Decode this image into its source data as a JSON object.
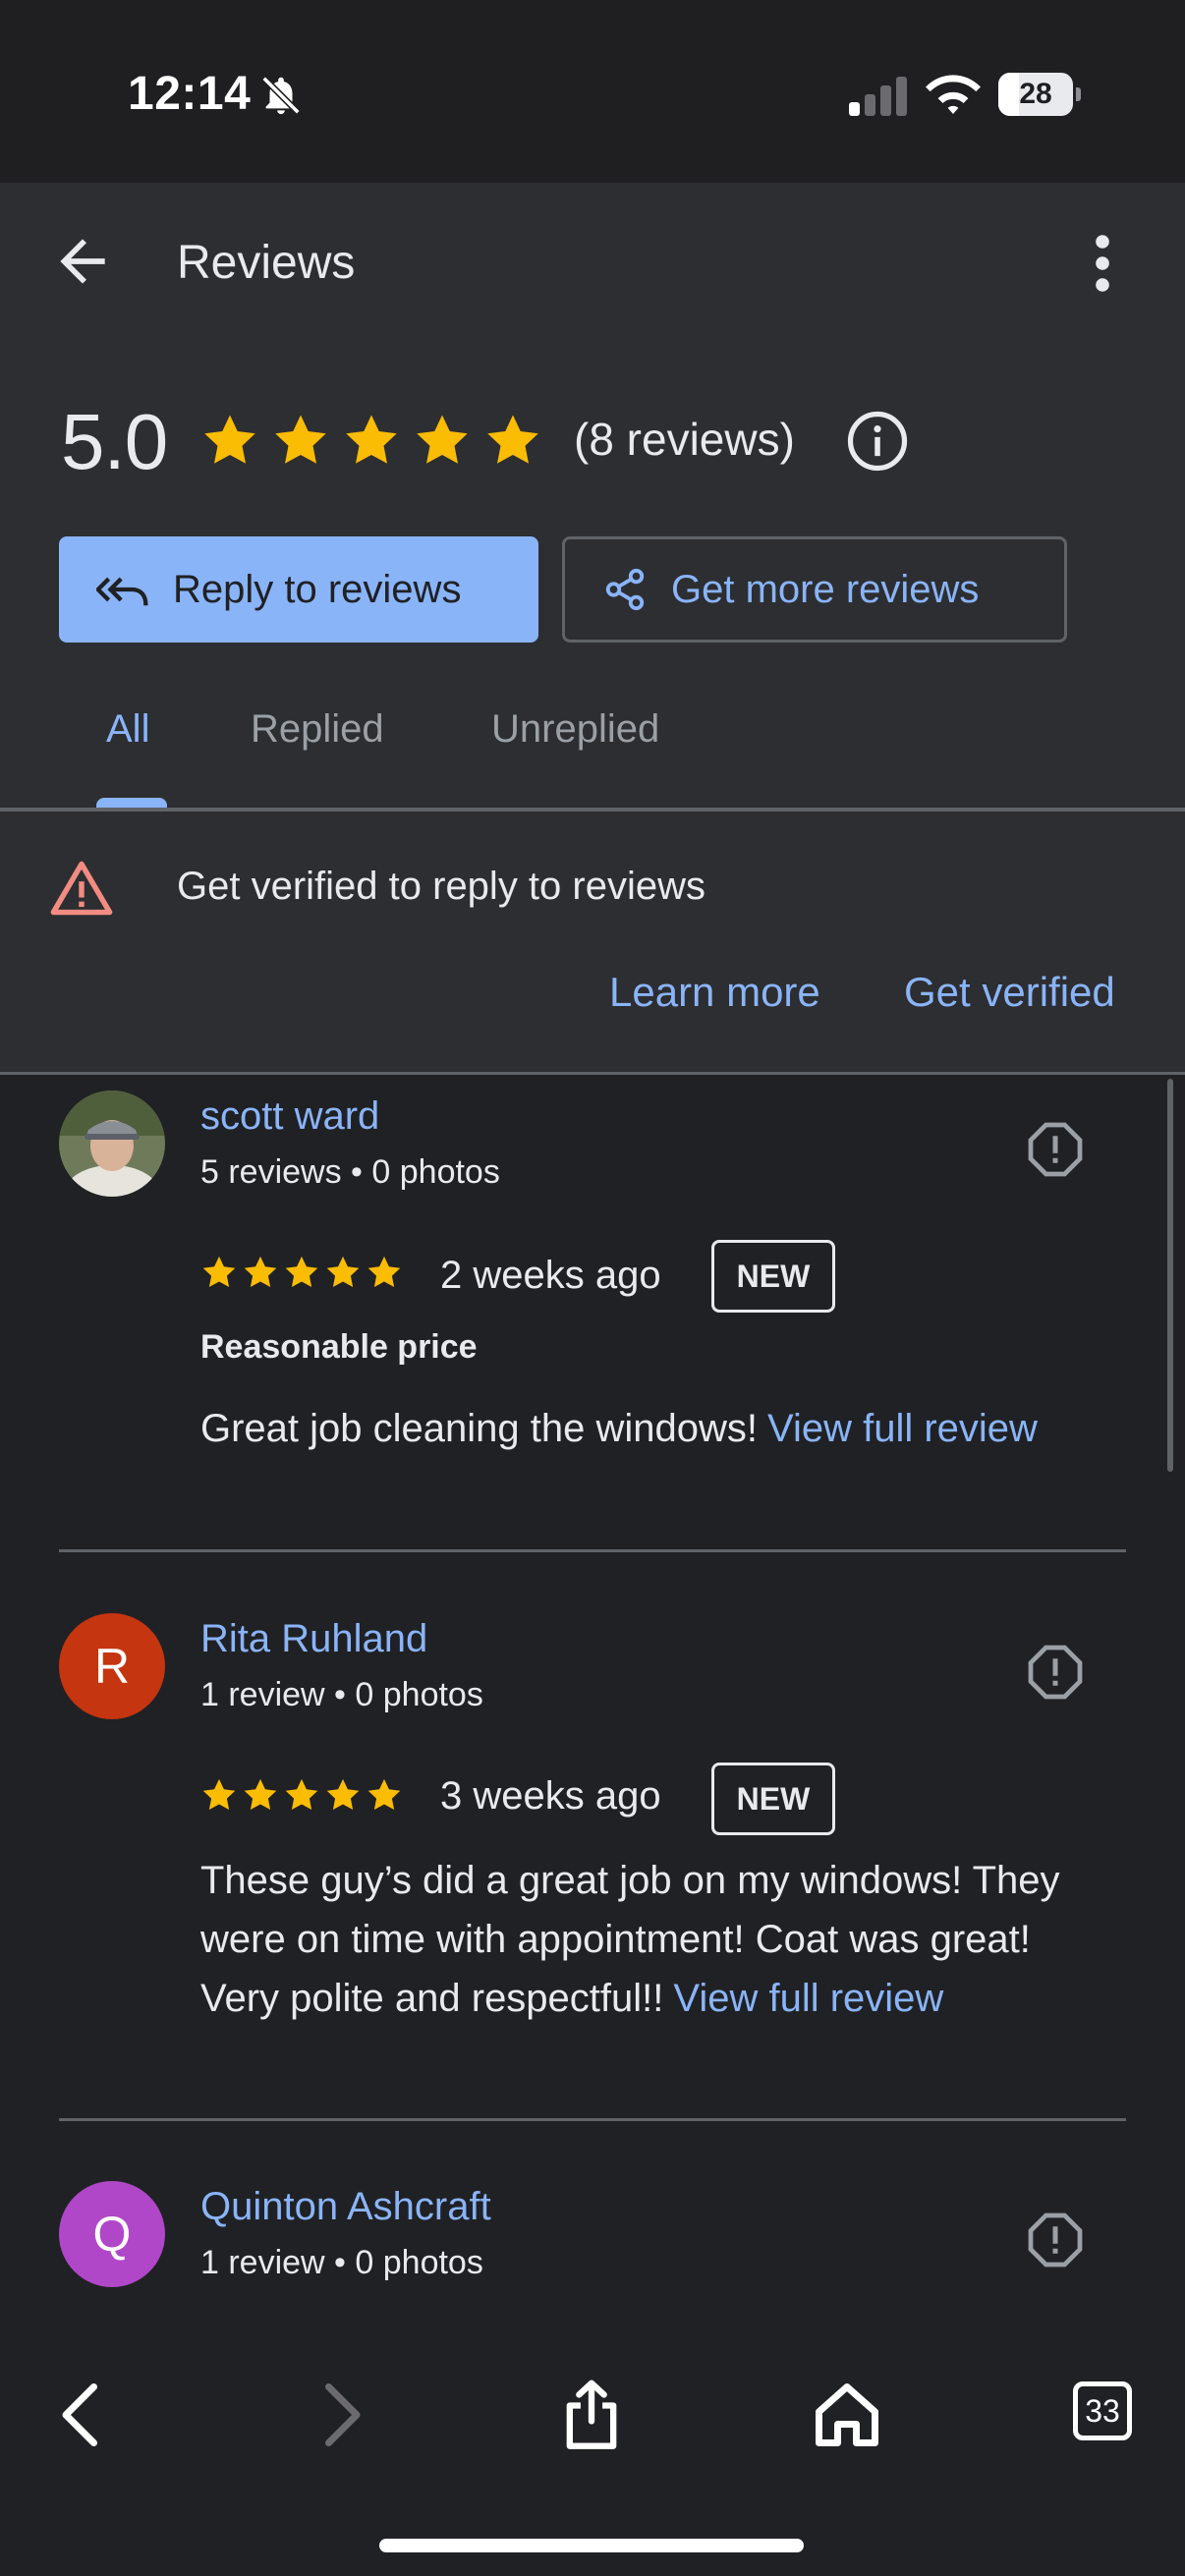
{
  "status_bar": {
    "time": "12:14",
    "battery": "28",
    "battery_level_pct": 28,
    "icons": [
      "bell-off-icon",
      "signal-icon",
      "wifi-icon",
      "battery-icon"
    ]
  },
  "header": {
    "title": "Reviews",
    "back_icon": "arrow-left-icon",
    "more_icon": "more-vert-icon"
  },
  "summary": {
    "rating": "5.0",
    "stars": 5,
    "review_count": "(8 reviews)",
    "info_icon": "info-icon"
  },
  "actions": {
    "reply_label": "Reply to reviews",
    "get_more_label": "Get more reviews"
  },
  "tabs": [
    {
      "label": "All",
      "active": true
    },
    {
      "label": "Replied",
      "active": false
    },
    {
      "label": "Unreplied",
      "active": false
    }
  ],
  "banner": {
    "text": "Get verified to reply to reviews",
    "learn_more": "Learn more",
    "get_verified": "Get verified",
    "icon": "warning-icon"
  },
  "reviews": [
    {
      "name": "scott ward",
      "meta": "5 reviews • 0 photos",
      "stars": 5,
      "time": "2 weeks ago",
      "badge": "NEW",
      "attribute": "Reasonable price",
      "text": "Great job cleaning the windows!",
      "view_full": "View full review",
      "avatar_type": "photo"
    },
    {
      "name": "Rita Ruhland",
      "meta": "1 review • 0 photos",
      "stars": 5,
      "time": "3 weeks ago",
      "badge": "NEW",
      "text_lines": [
        "These guy’s did a great job on my windows! They",
        "were on time with appointment! Coat was great!",
        "Very polite and respectful!!"
      ],
      "view_full": "View full review",
      "avatar_letter": "R",
      "avatar_color": "#c5350f"
    },
    {
      "name": "Quinton Ashcraft",
      "meta": "1 review • 0 photos",
      "avatar_letter": "Q",
      "avatar_color": "#b047c9"
    }
  ],
  "colors": {
    "accent": "#8ab4f8",
    "star": "#fbbc04",
    "warning": "#f28b82"
  },
  "bottom_bar": {
    "tab_count": "33",
    "icons": [
      "back-icon",
      "forward-icon",
      "share-icon",
      "home-icon",
      "tabs-icon"
    ]
  }
}
